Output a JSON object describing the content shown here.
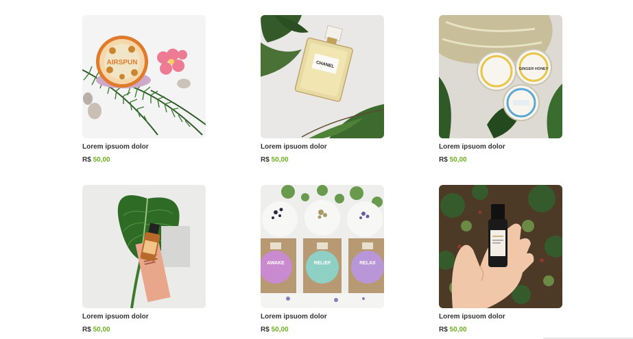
{
  "products": [
    {
      "name": "Lorem ipsuom dolor",
      "currency": "R$",
      "price": "50,00",
      "image_label": "AIRSPUN"
    },
    {
      "name": "Lorem ipsuom dolor",
      "currency": "R$",
      "price": "50,00",
      "image_label": "CHANEL"
    },
    {
      "name": "Lorem ipsuom dolor",
      "currency": "R$",
      "price": "50,00",
      "image_label": "GINGER HONEY"
    },
    {
      "name": "Lorem ipsuom dolor",
      "currency": "R$",
      "price": "50,00",
      "image_label": ""
    },
    {
      "name": "Lorem ipsuom dolor",
      "currency": "R$",
      "price": "50,00",
      "image_labels": [
        "AWAKE",
        "RELIEF",
        "RELAX"
      ]
    },
    {
      "name": "Lorem ipsuom dolor",
      "currency": "R$",
      "price": "50,00",
      "image_label": ""
    }
  ],
  "colors": {
    "price": "#6ab01f",
    "text": "#333333"
  }
}
